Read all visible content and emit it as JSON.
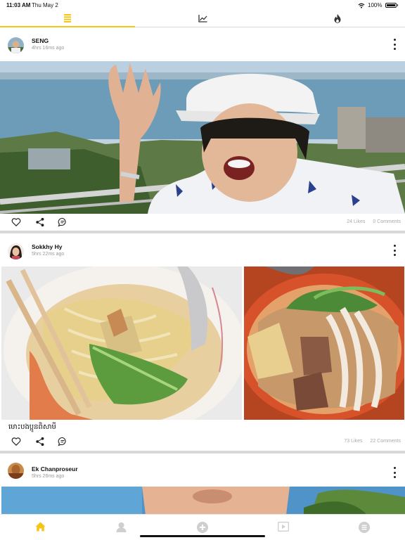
{
  "status_bar": {
    "time": "11:03 AM",
    "date": "Thu May 2",
    "battery": "100%"
  },
  "top_tabs": [
    {
      "icon": "feed-list-icon",
      "active": true
    },
    {
      "icon": "trending-chart-icon",
      "active": false
    },
    {
      "icon": "hot-flame-icon",
      "active": false
    }
  ],
  "posts": [
    {
      "user": "SENG",
      "time": "4hrs 16ms ago",
      "likes": "24 Likes",
      "comments": "0 Comments"
    },
    {
      "user": "Sokkhy Hy",
      "time": "5hrs 22ms ago",
      "caption": "មោះបងប្អូនពិសាមី",
      "likes": "73 Likes",
      "comments": "22 Comments"
    },
    {
      "user": "Ek Chanproseur",
      "time": "5hrs 26ms ago"
    }
  ],
  "bottom_nav": [
    {
      "icon": "home-icon",
      "active": true
    },
    {
      "icon": "profile-icon",
      "active": false
    },
    {
      "icon": "add-post-icon",
      "active": false
    },
    {
      "icon": "video-icon",
      "active": false
    },
    {
      "icon": "menu-icon",
      "active": false
    }
  ],
  "colors": {
    "accent": "#f5c518",
    "inactive_icon": "#cfcfcf",
    "meta_text": "#9a9a9a"
  }
}
